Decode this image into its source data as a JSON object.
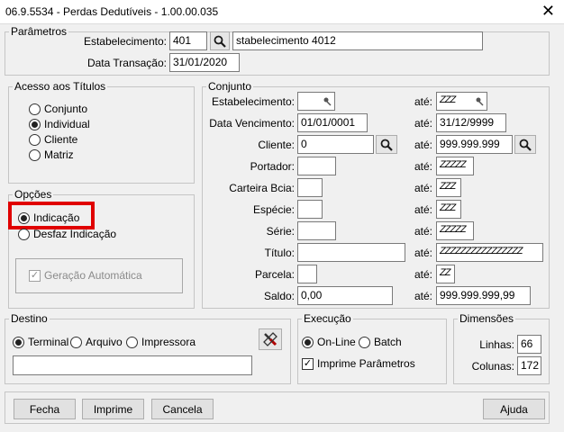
{
  "window": {
    "title": "06.9.5534 - Perdas Dedutíveis - 1.00.00.035",
    "close_glyph": "✕"
  },
  "parametros": {
    "legend": "Parâmetros",
    "estabelecimento_label": "Estabelecimento:",
    "estabelecimento_value": "401",
    "estabelecimento_desc": "stabelecimento 4012",
    "data_label": "Data Transação:",
    "data_value": "31/01/2020"
  },
  "acesso": {
    "legend": "Acesso aos Títulos",
    "options": [
      "Conjunto",
      "Individual",
      "Cliente",
      "Matriz"
    ],
    "selected": "Individual"
  },
  "opcoes": {
    "legend": "Opções",
    "options": [
      "Indicação",
      "Desfaz Indicação"
    ],
    "selected": "Indicação",
    "geracao_label": "Geração Automática",
    "geracao_checked": true
  },
  "conjunto": {
    "legend": "Conjunto",
    "ate_label": "até:",
    "rows": [
      {
        "label": "Estabelecimento:",
        "from": "",
        "to": "ZZZ"
      },
      {
        "label": "Data Vencimento:",
        "from": "01/01/0001",
        "to": "31/12/9999"
      },
      {
        "label": "Cliente:",
        "from": "0",
        "to": "999.999.999"
      },
      {
        "label": "Portador:",
        "from": "",
        "to": "ZZZZZ"
      },
      {
        "label": "Carteira Bcia:",
        "from": "",
        "to": "ZZZ"
      },
      {
        "label": "Espécie:",
        "from": "",
        "to": "ZZZ"
      },
      {
        "label": "Série:",
        "from": "",
        "to": "ZZZZZ"
      },
      {
        "label": "Título:",
        "from": "",
        "to": "ZZZZZZZZZZZZZZZZ"
      },
      {
        "label": "Parcela:",
        "from": "",
        "to": "ZZ"
      },
      {
        "label": "Saldo:",
        "from": "0,00",
        "to": "999.999.999,99"
      }
    ]
  },
  "destino": {
    "legend": "Destino",
    "options": [
      "Terminal",
      "Arquivo",
      "Impressora"
    ],
    "selected": "Terminal",
    "file_value": ""
  },
  "execucao": {
    "legend": "Execução",
    "options": [
      "On-Line",
      "Batch"
    ],
    "selected": "On-Line",
    "imprime_label": "Imprime Parâmetros",
    "imprime_checked": true
  },
  "dimensoes": {
    "legend": "Dimensões",
    "linhas_label": "Linhas:",
    "linhas_value": "66",
    "colunas_label": "Colunas:",
    "colunas_value": "172"
  },
  "buttons": {
    "fecha": "Fecha",
    "imprime": "Imprime",
    "cancela": "Cancela",
    "ajuda": "Ajuda"
  },
  "colors": {
    "highlight": "#e00000"
  },
  "icons": [
    "search-icon",
    "pin-icon",
    "tools-icon",
    "checkmark-icon"
  ]
}
